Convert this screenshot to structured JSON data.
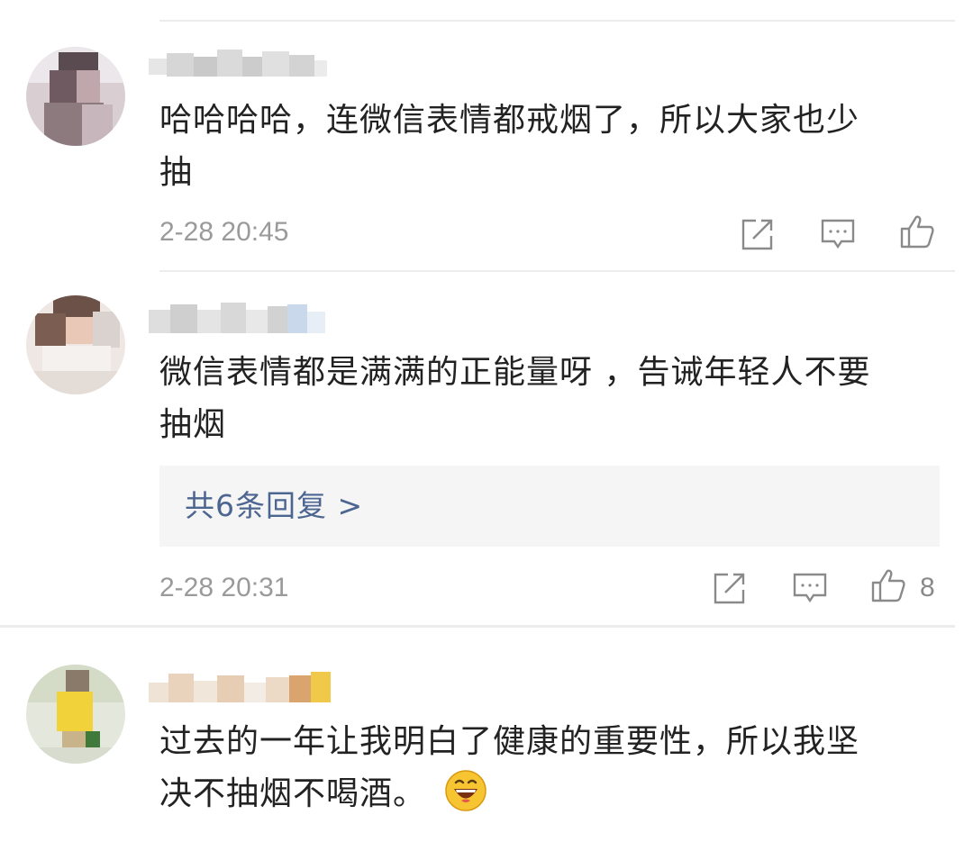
{
  "comments": [
    {
      "text": "哈哈哈哈，连微信表情都戒烟了，所以大家也少\n抽",
      "time": "2-28 20:45",
      "likes": ""
    },
    {
      "text": "微信表情都是满满的正能量呀 ，告诫年轻人不要\n抽烟",
      "replies_label": "共6条回复 >",
      "time": "2-28 20:31",
      "likes": "8"
    },
    {
      "text": "过去的一年让我明白了健康的重要性，所以我坚\n决不抽烟不喝酒。",
      "emoji": "grinning-face-emoji"
    }
  ],
  "icons": {
    "share": "share-icon",
    "reply": "comment-icon",
    "like": "thumbs-up-icon"
  },
  "colors": {
    "text": "#222222",
    "meta": "#9a9a9a",
    "link": "#4d6591",
    "divider": "#ececec",
    "reply_bg": "#f5f5f5"
  }
}
